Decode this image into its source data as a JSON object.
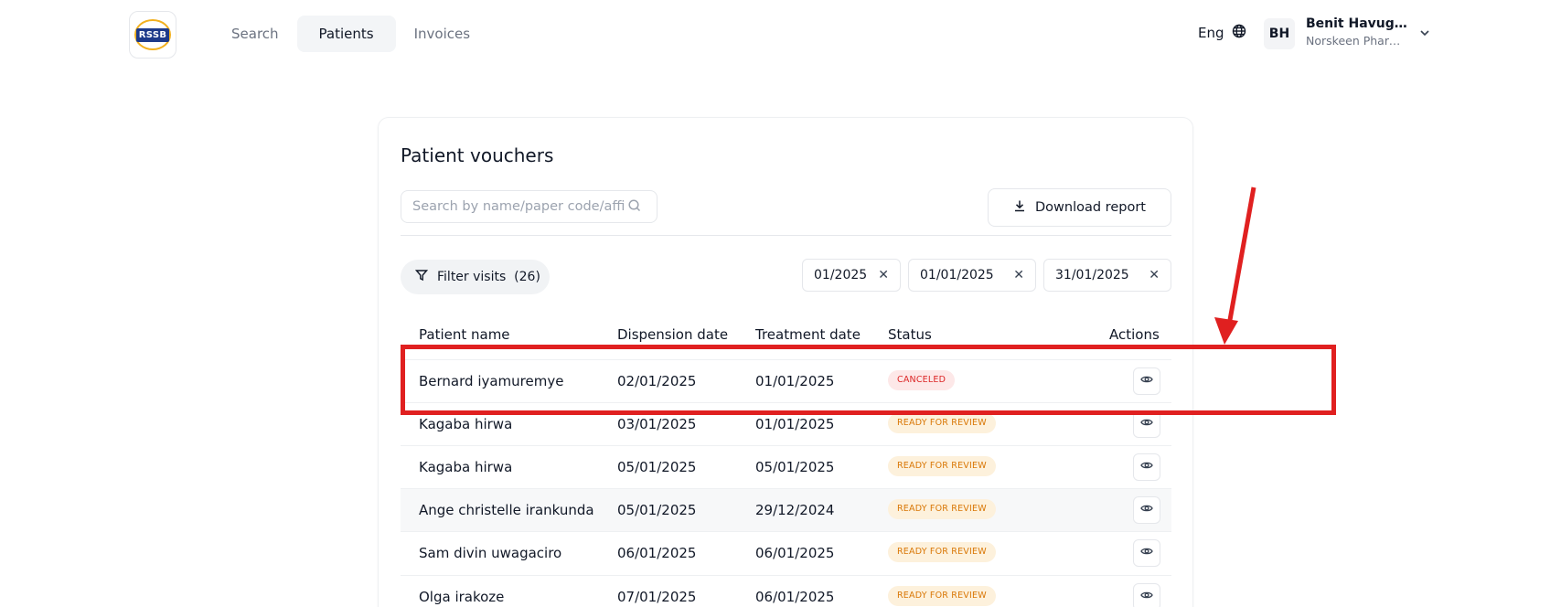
{
  "header": {
    "logo_text": "RSSB",
    "nav": [
      {
        "label": "Search",
        "active": false
      },
      {
        "label": "Patients",
        "active": true
      },
      {
        "label": "Invoices",
        "active": false
      }
    ],
    "language": "Eng",
    "user": {
      "initials": "BH",
      "name": "Benit Havugim...",
      "org": "Norskeen Pharma..."
    }
  },
  "card": {
    "title": "Patient vouchers",
    "search_placeholder": "Search by name/paper code/affiliate nu",
    "download_label": "Download report",
    "filter_label": "Filter visits",
    "filter_count": "(26)",
    "date_filters": [
      "01/2025",
      "01/01/2025",
      "31/01/2025"
    ],
    "columns": {
      "patient_name": "Patient name",
      "dispension_date": "Dispension date",
      "treatment_date": "Treatment date",
      "status": "Status",
      "actions": "Actions"
    },
    "rows": [
      {
        "name": "Bernard iyamuremye",
        "dispension": "02/01/2025",
        "treatment": "01/01/2025",
        "status": "CANCELED",
        "status_kind": "canceled"
      },
      {
        "name": "Kagaba hirwa",
        "dispension": "03/01/2025",
        "treatment": "01/01/2025",
        "status": "READY FOR REVIEW",
        "status_kind": "review"
      },
      {
        "name": "Kagaba hirwa",
        "dispension": "05/01/2025",
        "treatment": "05/01/2025",
        "status": "READY FOR REVIEW",
        "status_kind": "review"
      },
      {
        "name": "Ange christelle irankunda",
        "dispension": "05/01/2025",
        "treatment": "29/12/2024",
        "status": "READY FOR REVIEW",
        "status_kind": "review"
      },
      {
        "name": "Sam divin uwagaciro",
        "dispension": "06/01/2025",
        "treatment": "06/01/2025",
        "status": "READY FOR REVIEW",
        "status_kind": "review"
      },
      {
        "name": "Olga irakoze",
        "dispension": "07/01/2025",
        "treatment": "06/01/2025",
        "status": "READY FOR REVIEW",
        "status_kind": "review"
      }
    ]
  },
  "colors": {
    "annotation_red": "#e02020",
    "canceled_bg": "#fde8e8",
    "canceled_text": "#dc2626",
    "review_bg": "#fdf1dc",
    "review_text": "#d97706"
  }
}
